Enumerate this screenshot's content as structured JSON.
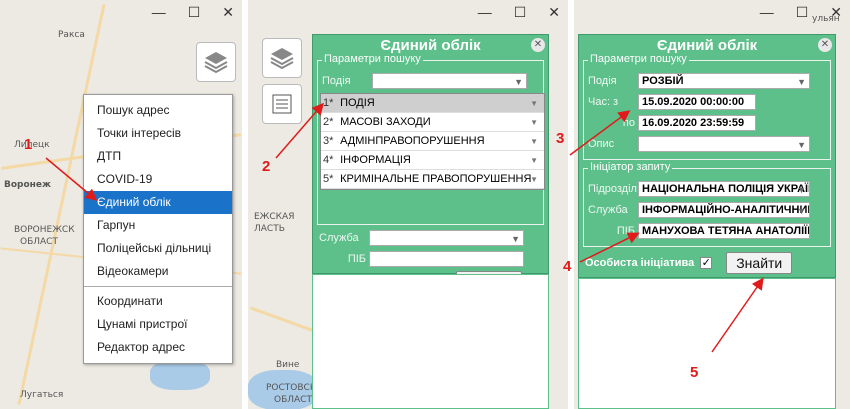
{
  "window_controls": {
    "minimize": "—",
    "maximize": "☐",
    "close": "✕"
  },
  "map_labels": {
    "p1": [
      "Ракса",
      "Липецк",
      "Воронеж",
      "ВОРОНЕЖСК",
      "ОБЛАСТ",
      "Лугаться"
    ],
    "p2": [
      "ЕЖСКАЯ",
      "ЛАСТЬ",
      "Вине",
      "РОСТОВСК",
      "ОБЛАСТ"
    ],
    "p3": [
      "ульян"
    ]
  },
  "context_menu": {
    "items": [
      "Пошук адрес",
      "Точки інтересів",
      "ДТП",
      "COVID-19",
      "Єдиний облік",
      "Гарпун",
      "Поліцейські дільниці",
      "Відеокамери"
    ],
    "items2": [
      "Координати",
      "Цунамі пристрої",
      "Редактор адрес"
    ],
    "active": "Єдиний облік"
  },
  "dialog": {
    "title": "Єдиний облік",
    "search_params_legend": "Параметри пошуку",
    "event_label": "Подія",
    "time_from_label": "Час: з",
    "time_to_label": "по",
    "description_label": "Опис",
    "initiator_legend": "Ініціатор запиту",
    "unit_label": "Підрозділ",
    "service_label": "Служба",
    "name_label": "ПІБ",
    "own_initiative_label": "Особиста ініціатива",
    "find_button": "Знайти"
  },
  "dropdown_options": [
    {
      "num": "1*",
      "label": "ПОДІЯ"
    },
    {
      "num": "2*",
      "label": "МАСОВІ ЗАХОДИ"
    },
    {
      "num": "3*",
      "label": "АДМІНПРАВОПОРУШЕННЯ"
    },
    {
      "num": "4*",
      "label": "ІНФОРМАЦІЯ"
    },
    {
      "num": "5*",
      "label": "КРИМІНАЛЬНЕ ПРАВОПОРУШЕННЯ"
    }
  ],
  "filled": {
    "event": "РОЗБІЙ",
    "time_from": "15.09.2020 00:00:00",
    "time_to": "16.09.2020 23:59:59",
    "unit": "НАЦІОНАЛЬНА ПОЛІЦІЯ УКРАЇНИ",
    "service": "ІНФОРМАЦІЙНО-АНАЛІТИЧНИЙ",
    "name": "МАНУХОВА ТЕТЯНА АНАТОЛІЇВНА",
    "own_initiative_checked": "✓"
  },
  "annotations": [
    "1",
    "2",
    "3",
    "4",
    "5"
  ],
  "colors": {
    "dialog": "#5dbf8a",
    "annotation": "#e01b1b",
    "menu_active": "#1a73c8"
  }
}
